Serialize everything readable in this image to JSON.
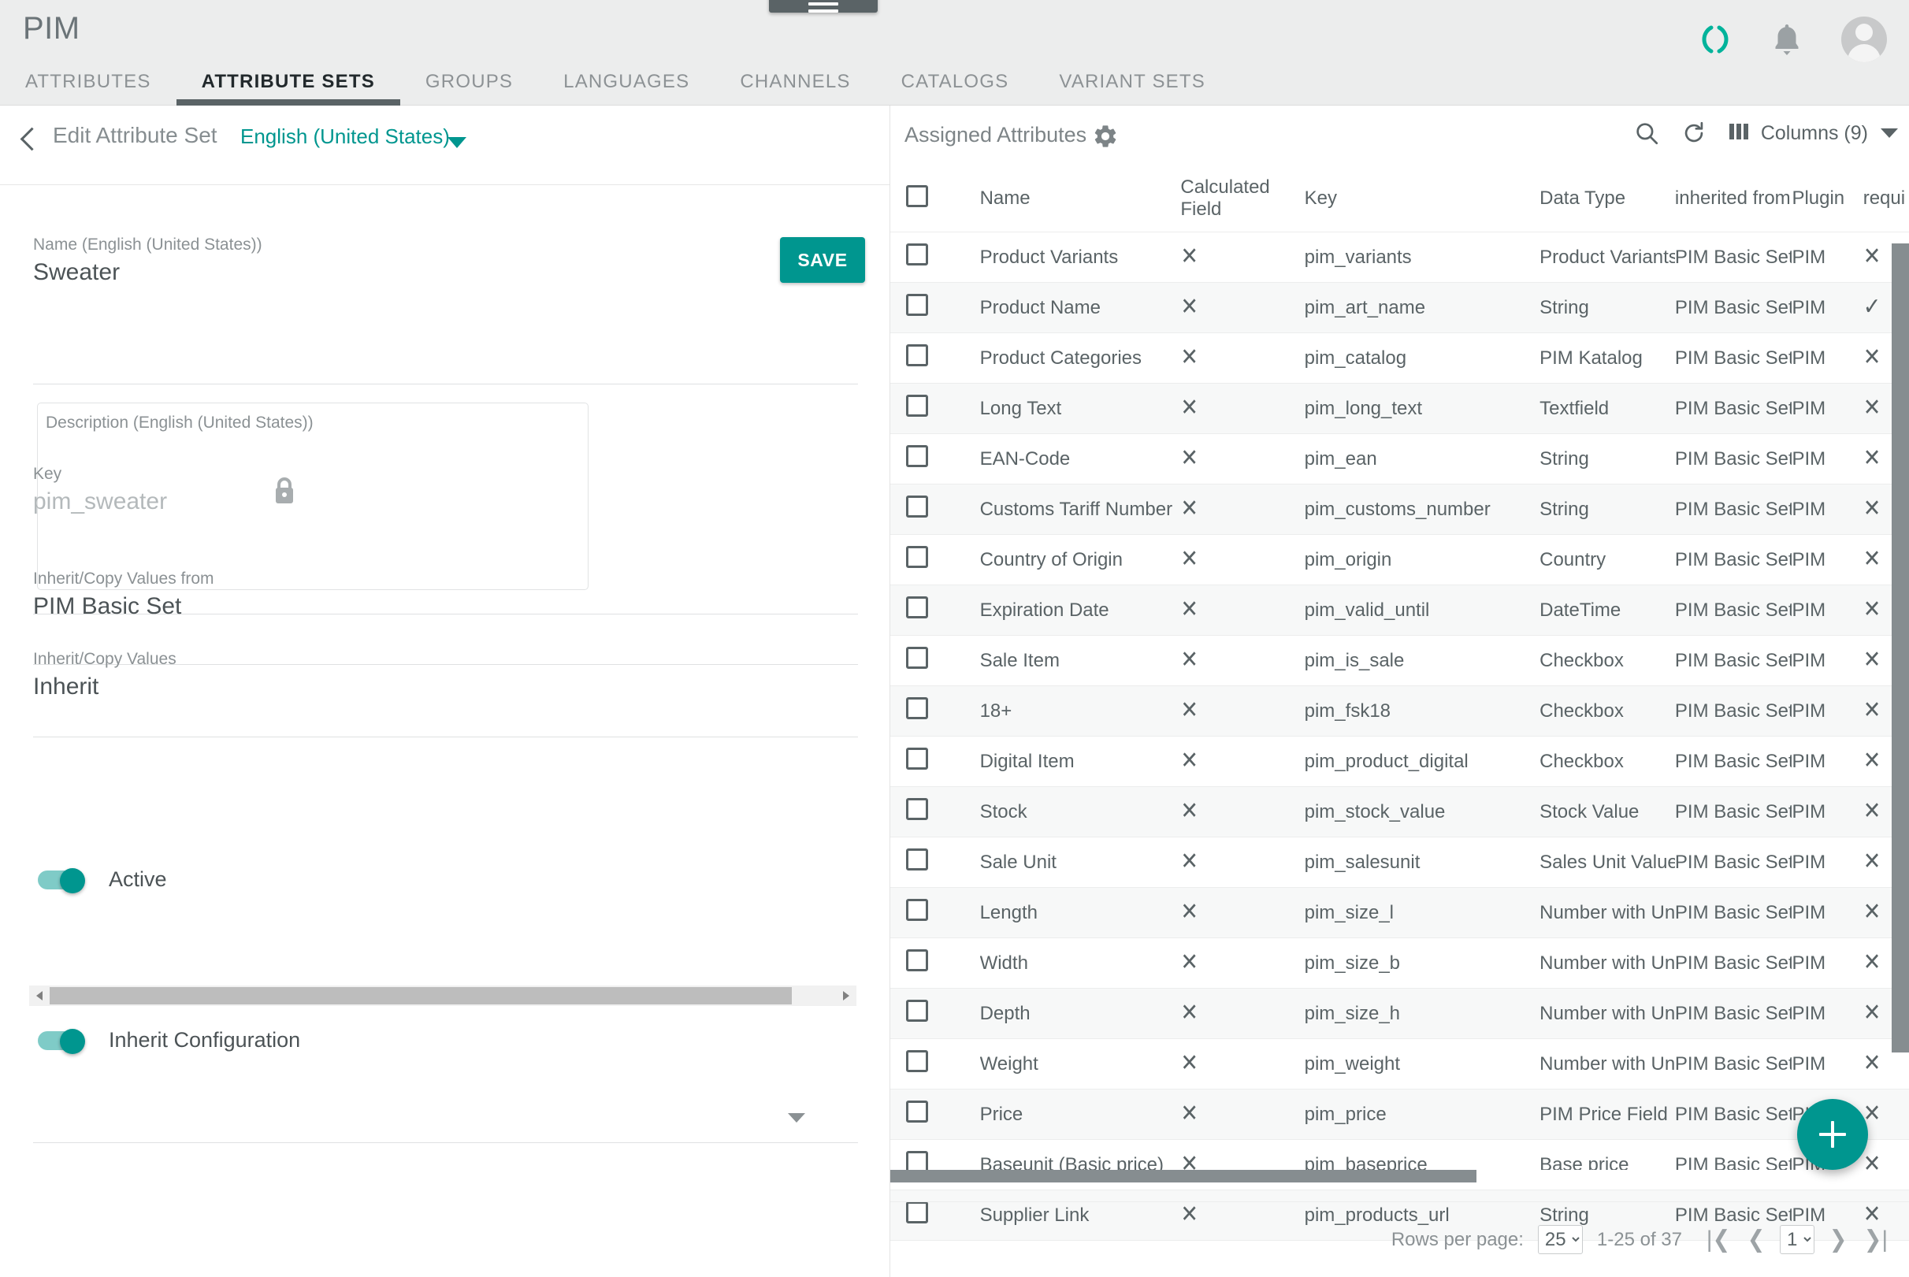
{
  "app": {
    "brand": "PIM",
    "menu_icon": "hamburger-icon",
    "loading_icon": "spinner-icon",
    "notifications_icon": "bell-icon",
    "avatar_icon": "user-avatar-icon",
    "accent_color": "#00968f",
    "header_bg": "#eceded"
  },
  "tabs": [
    {
      "label": "ATTRIBUTES",
      "active": false
    },
    {
      "label": "ATTRIBUTE SETS",
      "active": true
    },
    {
      "label": "GROUPS",
      "active": false
    },
    {
      "label": "LANGUAGES",
      "active": false
    },
    {
      "label": "CHANNELS",
      "active": false
    },
    {
      "label": "CATALOGS",
      "active": false
    },
    {
      "label": "VARIANT SETS",
      "active": false
    }
  ],
  "left_panel": {
    "back_icon": "chevron-left-icon",
    "title": "Edit Attribute Set",
    "language": "English (United States)",
    "language_caret_icon": "chevron-down-icon",
    "save_label": "SAVE",
    "name_field": {
      "label": "Name (English (United States))",
      "value": "Sweater"
    },
    "description_field": {
      "placeholder": "Description (English (United States))",
      "value": ""
    },
    "key_field": {
      "label": "Key",
      "value": "pim_sweater",
      "lock_icon": "lock-icon"
    },
    "active_toggle": {
      "label": "Active",
      "on": true
    },
    "inherit_from": {
      "label": "Inherit/Copy Values from",
      "value": "PIM Basic Set"
    },
    "inherit_config_toggle": {
      "label": "Inherit Configuration",
      "on": true
    },
    "inherit_values": {
      "label": "Inherit/Copy Values",
      "value": "Inherit"
    },
    "scrollbar": {
      "left_arrow_icon": "arrow-left-icon",
      "right_arrow_icon": "arrow-right-icon"
    }
  },
  "right_panel": {
    "title": "Assigned Attributes",
    "settings_icon": "gear-icon",
    "search_icon": "search-icon",
    "refresh_icon": "refresh-icon",
    "columns_icon": "columns-icon",
    "columns_label": "Columns (9)",
    "columns_caret_icon": "chevron-down-icon",
    "add_icon": "plus-icon",
    "columns": [
      "Name",
      "Calculated Field",
      "Key",
      "Data Type",
      "inherited from",
      "Plugin",
      "requi"
    ],
    "rows": [
      {
        "name": "Product Variants",
        "calculated": "✕",
        "key": "pim_variants",
        "type": "Product Variants",
        "inherited": "PIM Basic Set",
        "plugin": "PIM",
        "required": "✕"
      },
      {
        "name": "Product Name",
        "calculated": "✕",
        "key": "pim_art_name",
        "type": "String",
        "inherited": "PIM Basic Set",
        "plugin": "PIM",
        "required": "✓"
      },
      {
        "name": "Product Categories",
        "calculated": "✕",
        "key": "pim_catalog",
        "type": "PIM Katalog",
        "inherited": "PIM Basic Set",
        "plugin": "PIM",
        "required": "✕"
      },
      {
        "name": "Long Text",
        "calculated": "✕",
        "key": "pim_long_text",
        "type": "Textfield",
        "inherited": "PIM Basic Set",
        "plugin": "PIM",
        "required": "✕"
      },
      {
        "name": "EAN-Code",
        "calculated": "✕",
        "key": "pim_ean",
        "type": "String",
        "inherited": "PIM Basic Set",
        "plugin": "PIM",
        "required": "✕"
      },
      {
        "name": "Customs Tariff Number",
        "calculated": "✕",
        "key": "pim_customs_number",
        "type": "String",
        "inherited": "PIM Basic Set",
        "plugin": "PIM",
        "required": "✕"
      },
      {
        "name": "Country of Origin",
        "calculated": "✕",
        "key": "pim_origin",
        "type": "Country",
        "inherited": "PIM Basic Set",
        "plugin": "PIM",
        "required": "✕"
      },
      {
        "name": "Expiration Date",
        "calculated": "✕",
        "key": "pim_valid_until",
        "type": "DateTime",
        "inherited": "PIM Basic Set",
        "plugin": "PIM",
        "required": "✕"
      },
      {
        "name": "Sale Item",
        "calculated": "✕",
        "key": "pim_is_sale",
        "type": "Checkbox",
        "inherited": "PIM Basic Set",
        "plugin": "PIM",
        "required": "✕"
      },
      {
        "name": "18+",
        "calculated": "✕",
        "key": "pim_fsk18",
        "type": "Checkbox",
        "inherited": "PIM Basic Set",
        "plugin": "PIM",
        "required": "✕"
      },
      {
        "name": "Digital Item",
        "calculated": "✕",
        "key": "pim_product_digital",
        "type": "Checkbox",
        "inherited": "PIM Basic Set",
        "plugin": "PIM",
        "required": "✕"
      },
      {
        "name": "Stock",
        "calculated": "✕",
        "key": "pim_stock_value",
        "type": "Stock Value",
        "inherited": "PIM Basic Set",
        "plugin": "PIM",
        "required": "✕"
      },
      {
        "name": "Sale Unit",
        "calculated": "✕",
        "key": "pim_salesunit",
        "type": "Sales Unit Value",
        "inherited": "PIM Basic Set",
        "plugin": "PIM",
        "required": "✕"
      },
      {
        "name": "Length",
        "calculated": "✕",
        "key": "pim_size_l",
        "type": "Number with Unit",
        "inherited": "PIM Basic Set",
        "plugin": "PIM",
        "required": "✕"
      },
      {
        "name": "Width",
        "calculated": "✕",
        "key": "pim_size_b",
        "type": "Number with Unit",
        "inherited": "PIM Basic Set",
        "plugin": "PIM",
        "required": "✕"
      },
      {
        "name": "Depth",
        "calculated": "✕",
        "key": "pim_size_h",
        "type": "Number with Unit",
        "inherited": "PIM Basic Set",
        "plugin": "PIM",
        "required": "✕"
      },
      {
        "name": "Weight",
        "calculated": "✕",
        "key": "pim_weight",
        "type": "Number with Unit",
        "inherited": "PIM Basic Set",
        "plugin": "PIM",
        "required": "✕"
      },
      {
        "name": "Price",
        "calculated": "✕",
        "key": "pim_price",
        "type": "PIM Price Field",
        "inherited": "PIM Basic Set",
        "plugin": "PIM",
        "required": "✕"
      },
      {
        "name": "Baseunit (Basic price)",
        "calculated": "✕",
        "key": "pim_baseprice",
        "type": "Base price",
        "inherited": "PIM Basic Set",
        "plugin": "PIM",
        "required": "✕"
      },
      {
        "name": "Supplier Link",
        "calculated": "✕",
        "key": "pim_products_url",
        "type": "String",
        "inherited": "PIM Basic Set",
        "plugin": "PIM",
        "required": "✕"
      }
    ],
    "paginator": {
      "rows_per_page_label": "Rows per page:",
      "rows_per_page_value": "25",
      "rows_per_page_options": [
        "25"
      ],
      "range": "1-25 of 37",
      "first_icon": "first-page-icon",
      "prev_icon": "prev-page-icon",
      "page_value": "1",
      "page_options": [
        "1"
      ],
      "next_icon": "next-page-icon",
      "last_icon": "last-page-icon"
    }
  }
}
